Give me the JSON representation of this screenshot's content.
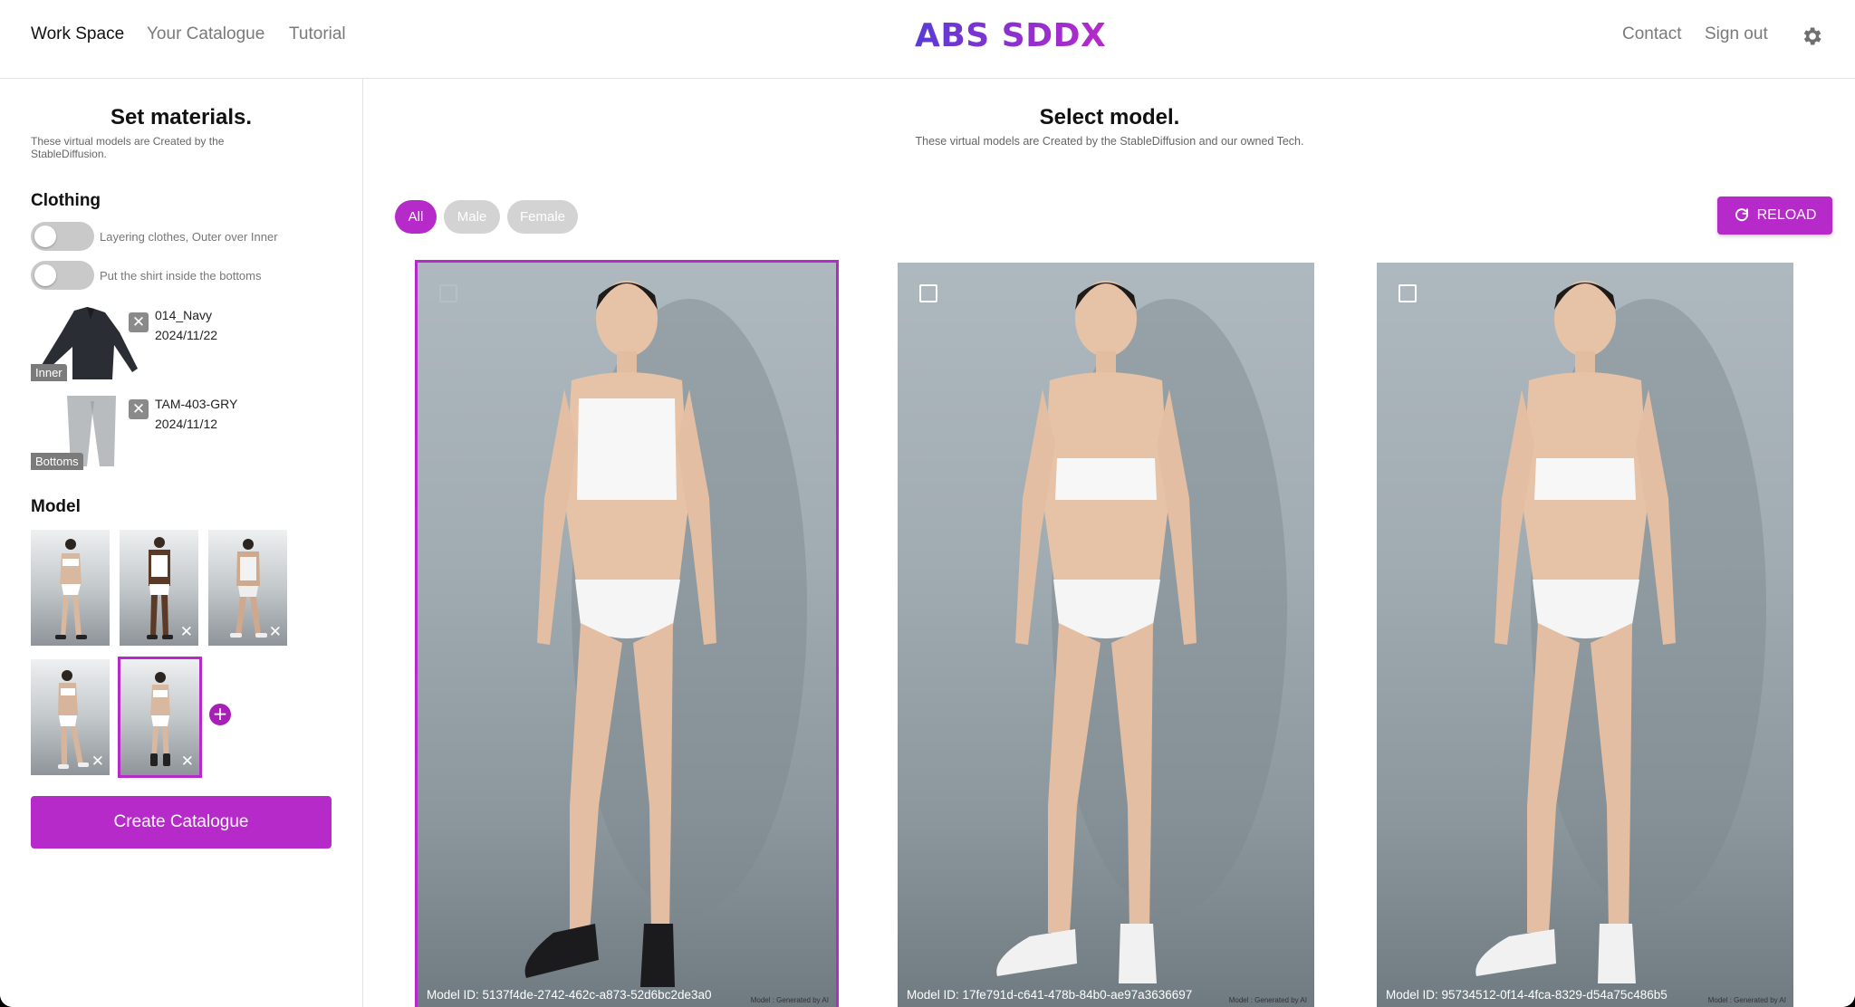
{
  "header": {
    "nav": [
      "Work Space",
      "Your Catalogue",
      "Tutorial"
    ],
    "logo": "ABS SDDX",
    "right_nav": [
      "Contact",
      "Sign out"
    ],
    "settings_icon": "gear-icon"
  },
  "sidebar": {
    "title": "Set materials.",
    "subtitle": "These virtual models are Created by the StableDiffusion.",
    "clothing": {
      "heading": "Clothing",
      "toggles": [
        {
          "label": "Layering clothes, Outer over Inner",
          "on": false
        },
        {
          "label": "Put the shirt inside the bottoms",
          "on": false
        }
      ],
      "items": [
        {
          "badge": "Inner",
          "name": "014_Navy",
          "date": "2024/11/22",
          "remove_icon": "close-icon"
        },
        {
          "badge": "Bottoms",
          "name": "TAM-403-GRY",
          "date": "2024/11/12",
          "remove_icon": "close-icon"
        }
      ]
    },
    "model": {
      "heading": "Model",
      "remove_glyph": "✕",
      "add_glyph": "+"
    },
    "create_button": "Create Catalogue"
  },
  "main": {
    "title": "Select model.",
    "subtitle": "These virtual models are Created by the StableDiffusion and our owned Tech.",
    "filters": [
      "All",
      "Male",
      "Female"
    ],
    "active_filter": "All",
    "reload_label": "RELOAD",
    "cards": [
      {
        "model_id": "Model ID: 5137f4de-2742-462c-a873-52d6bc2de3a0",
        "footer": "Model : Generated by AI",
        "selected": true
      },
      {
        "model_id": "Model ID: 17fe791d-c641-478b-84b0-ae97a3636697",
        "footer": "Model : Generated by AI",
        "selected": false
      },
      {
        "model_id": "Model ID: 95734512-0f14-4fca-8329-d54a75c486b5",
        "footer": "Model : Generated by AI",
        "selected": false
      }
    ]
  },
  "colors": {
    "accent": "#b52ac9",
    "logo_start": "#5a3bd4",
    "logo_end": "#b52ac9"
  }
}
